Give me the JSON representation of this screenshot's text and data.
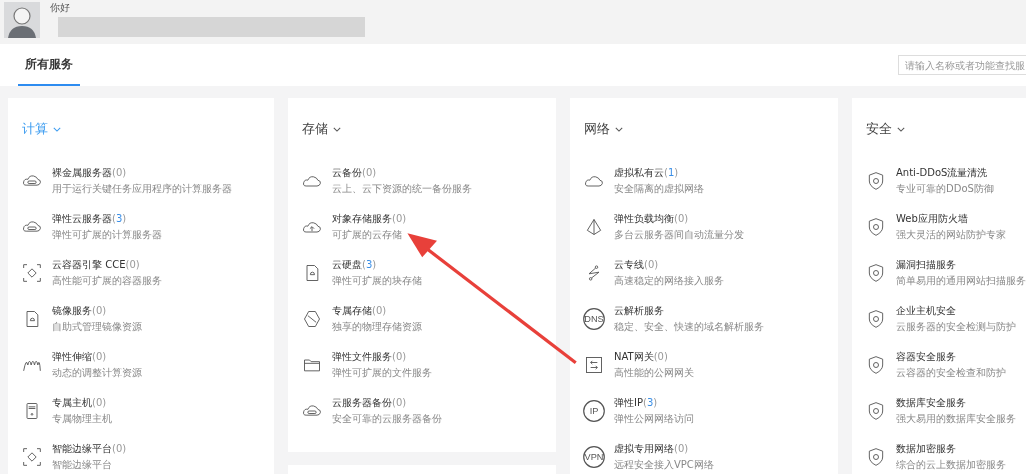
{
  "user": {
    "greeting": "你好"
  },
  "tabs": [
    {
      "label": "所有服务",
      "selected": true
    }
  ],
  "search": {
    "placeholder": "请输入名称或者功能查找服"
  },
  "categories": [
    {
      "title": "计算",
      "selected": true,
      "items": [
        {
          "name": "裸金属服务器",
          "count": "(0)",
          "has_resources": false,
          "desc": "用于运行关键任务应用程序的计算服务器"
        },
        {
          "name": "弹性云服务器",
          "count": "(3)",
          "has_resources": true,
          "desc": "弹性可扩展的计算服务器"
        },
        {
          "name": "云容器引擎 CCE",
          "count": "(0)",
          "has_resources": false,
          "desc": "高性能可扩展的容器服务"
        },
        {
          "name": "镜像服务",
          "count": "(0)",
          "has_resources": false,
          "desc": "自助式管理镜像资源"
        },
        {
          "name": "弹性伸缩",
          "count": "(0)",
          "has_resources": false,
          "desc": "动态的调整计算资源"
        },
        {
          "name": "专属主机",
          "count": "(0)",
          "has_resources": false,
          "desc": "专属物理主机"
        },
        {
          "name": "智能边缘平台",
          "count": "(0)",
          "has_resources": false,
          "desc": "智能边缘平台"
        }
      ]
    },
    {
      "title": "存储",
      "selected": false,
      "items": [
        {
          "name": "云备份",
          "count": "(0)",
          "has_resources": false,
          "desc": "云上、云下资源的统一备份服务"
        },
        {
          "name": "对象存储服务",
          "count": "(0)",
          "has_resources": false,
          "desc": "可扩展的云存储"
        },
        {
          "name": "云硬盘",
          "count": "(3)",
          "has_resources": true,
          "desc": "弹性可扩展的块存储"
        },
        {
          "name": "专属存储",
          "count": "(0)",
          "has_resources": false,
          "desc": "独享的物理存储资源"
        },
        {
          "name": "弹性文件服务",
          "count": "(0)",
          "has_resources": false,
          "desc": "弹性可扩展的文件服务"
        },
        {
          "name": "云服务器备份",
          "count": "(0)",
          "has_resources": false,
          "desc": "安全可靠的云服务器备份"
        }
      ]
    },
    {
      "title": "网络",
      "selected": false,
      "items": [
        {
          "name": "虚拟私有云",
          "count": "(1)",
          "has_resources": true,
          "desc": "安全隔离的虚拟网络"
        },
        {
          "name": "弹性负载均衡",
          "count": "(0)",
          "has_resources": false,
          "desc": "多台云服务器间自动流量分发"
        },
        {
          "name": "云专线",
          "count": "(0)",
          "has_resources": false,
          "desc": "高速稳定的网络接入服务"
        },
        {
          "name": "云解析服务",
          "icon_text": "DNS",
          "desc": "稳定、安全、快速的域名解析服务"
        },
        {
          "name": "NAT网关",
          "count": "(0)",
          "has_resources": false,
          "desc": "高性能的公网网关"
        },
        {
          "name": "弹性IP",
          "count": "(3)",
          "has_resources": true,
          "icon_text": "IP",
          "desc": "弹性公网网络访问"
        },
        {
          "name": "虚拟专用网络",
          "count": "(0)",
          "has_resources": false,
          "icon_text": "VPN",
          "desc": "远程安全接入VPC网络"
        }
      ]
    },
    {
      "title": "安全",
      "selected": false,
      "items": [
        {
          "name": "Anti-DDoS流量清洗",
          "desc": "专业可靠的DDoS防御"
        },
        {
          "name": "Web应用防火墙",
          "desc": "强大灵活的网站防护专家"
        },
        {
          "name": "漏洞扫描服务",
          "desc": "简单易用的通用网站扫描服务"
        },
        {
          "name": "企业主机安全",
          "desc": "云服务器的安全检测与防护"
        },
        {
          "name": "容器安全服务",
          "desc": "云容器的安全检查和防护"
        },
        {
          "name": "数据库安全服务",
          "desc": "强大易用的数据库安全服务"
        },
        {
          "name": "数据加密服务",
          "desc": "综合的云上数据加密服务"
        }
      ]
    }
  ]
}
